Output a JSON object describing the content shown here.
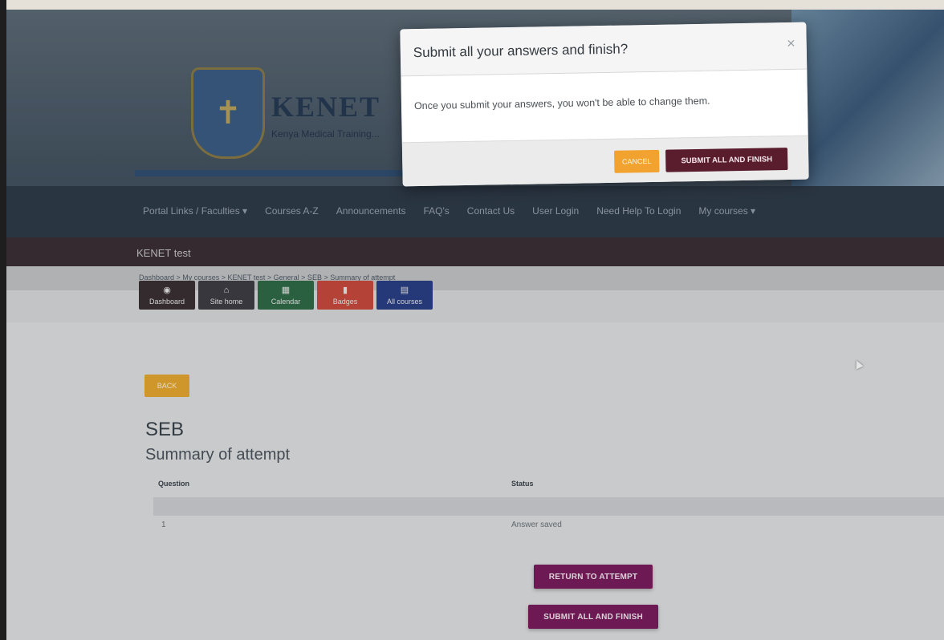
{
  "site": {
    "name": "KENET",
    "tagline": "Kenya Medical Training..."
  },
  "nav": {
    "items": [
      "Portal Links / Faculties ▾",
      "Courses A-Z",
      "Announcements",
      "FAQ's",
      "Contact Us",
      "User Login",
      "Need Help To Login",
      "My courses ▾"
    ]
  },
  "course": {
    "title": "KENET test"
  },
  "breadcrumb": "Dashboard > My courses > KENET test > General > SEB > Summary of attempt",
  "quicknav": [
    {
      "label": "Dashboard",
      "icon": "dashboard-icon",
      "glyph": "◉",
      "color": "#3a3034"
    },
    {
      "label": "Site home",
      "icon": "home-icon",
      "glyph": "⌂",
      "color": "#3f3e44"
    },
    {
      "label": "Calendar",
      "icon": "calendar-icon",
      "glyph": "▦",
      "color": "#2f6b48"
    },
    {
      "label": "Badges",
      "icon": "badge-icon",
      "glyph": "▮",
      "color": "#c94a3e"
    },
    {
      "label": "All courses",
      "icon": "courses-icon",
      "glyph": "▤",
      "color": "#2a3f86"
    }
  ],
  "main": {
    "back_label": "BACK",
    "quiz_title": "SEB",
    "subtitle": "Summary of attempt",
    "table": {
      "headers": [
        "Question",
        "Status"
      ],
      "rows": [
        {
          "question": "1",
          "status": "Answer saved"
        }
      ]
    },
    "return_label": "RETURN TO ATTEMPT",
    "submit_label": "SUBMIT ALL AND FINISH"
  },
  "modal": {
    "title": "Submit all your answers and finish?",
    "close_glyph": "×",
    "message": "Once you submit your answers, you won't be able to change them.",
    "cancel_label": "CANCEL",
    "submit_label": "SUBMIT ALL AND FINISH"
  }
}
